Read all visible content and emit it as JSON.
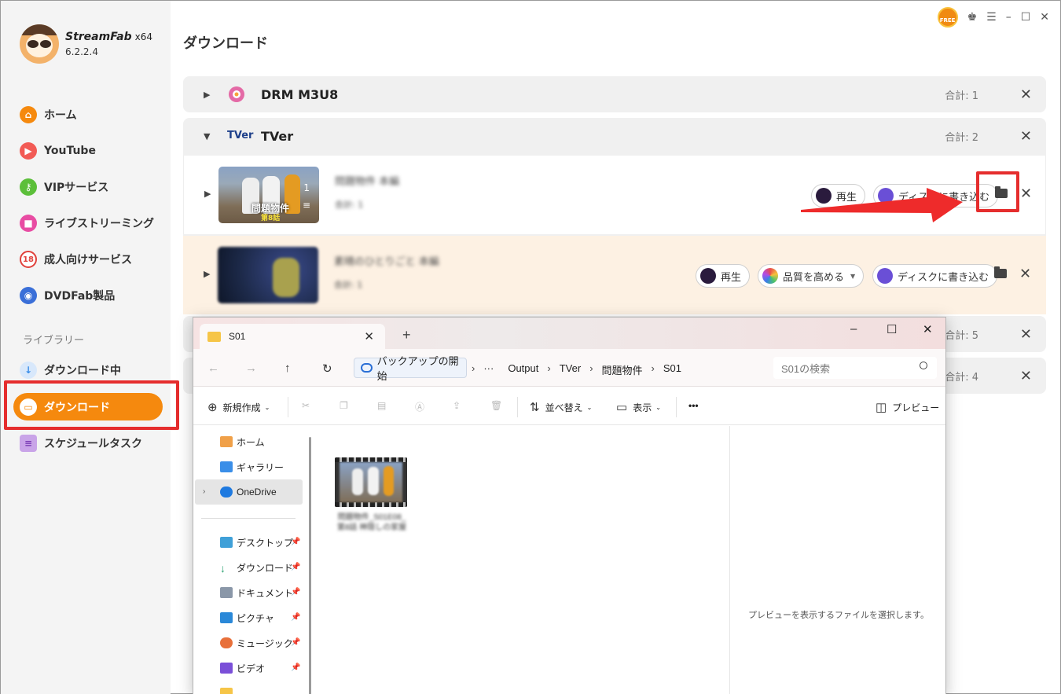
{
  "app": {
    "name": "StreamFab",
    "arch": "x64",
    "version": "6.2.2.4"
  },
  "header": {
    "title": "ダウンロード",
    "free_badge": "FREE"
  },
  "sidebar": {
    "items": [
      {
        "label": "ホーム",
        "icon": "home-icon",
        "color": "#f5890e"
      },
      {
        "label": "YouTube",
        "icon": "youtube-icon",
        "color": "#f25b55"
      },
      {
        "label": "VIPサービス",
        "icon": "key-icon",
        "color": "#5cbf3a"
      },
      {
        "label": "ライブストリーミング",
        "icon": "live-camera-icon",
        "color": "#e84ca3"
      },
      {
        "label": "成人向けサービス",
        "icon": "adult-18-icon",
        "color": "#e0413b"
      },
      {
        "label": "DVDFab製品",
        "icon": "dvdfab-icon",
        "color": "#3a6fd8"
      }
    ],
    "library_label": "ライブラリー",
    "library_items": [
      {
        "label": "ダウンロード中",
        "icon": "download-arrow-icon",
        "color": "#3a8ee8"
      },
      {
        "label": "ダウンロード",
        "icon": "folder-icon",
        "color": "#f5890e",
        "active": true
      },
      {
        "label": "スケジュールタスク",
        "icon": "schedule-icon",
        "color": "#9b59d0"
      }
    ]
  },
  "groups": [
    {
      "name": "DRM M3U8",
      "total": "合計: 1",
      "expanded": false
    },
    {
      "name": "TVer",
      "total": "合計: 2",
      "expanded": true,
      "items": [
        {
          "title": "問題物件 本編",
          "subtitle": "合計: 1",
          "thumb_count": "1",
          "thumb_caption": "問題物件",
          "thumb_episode": "第8話",
          "buttons": {
            "play": "再生",
            "burn": "ディスクに書き込む"
          }
        },
        {
          "title": "素晴のひとりごと 本編",
          "subtitle": "合計: 1",
          "buttons": {
            "play": "再生",
            "enhance": "品質を高める",
            "burn": "ディスクに書き込む"
          }
        }
      ]
    },
    {
      "name": "",
      "total": "合計: 5",
      "expanded": false
    },
    {
      "name": "",
      "total": "合計: 4",
      "expanded": false
    }
  ],
  "explorer": {
    "tab_title": "S01",
    "backup_label": "バックアップの開始",
    "breadcrumb": [
      "Output",
      "TVer",
      "問題物件",
      "S01"
    ],
    "search_placeholder": "S01の検索",
    "toolbar": {
      "new": "新規作成",
      "sort": "並べ替え",
      "view": "表示",
      "more": "•••",
      "preview": "プレビュー"
    },
    "nav": [
      {
        "label": "ホーム",
        "pinned": false
      },
      {
        "label": "ギャラリー",
        "pinned": false
      },
      {
        "label": "OneDrive",
        "pinned": false,
        "selected": true
      },
      {
        "label": "デスクトップ",
        "pinned": true
      },
      {
        "label": "ダウンロード",
        "pinned": true
      },
      {
        "label": "ドキュメント",
        "pinned": true
      },
      {
        "label": "ピクチャ",
        "pinned": true
      },
      {
        "label": "ミュージック",
        "pinned": true
      },
      {
        "label": "ビデオ",
        "pinned": true
      }
    ],
    "file": {
      "name": "問題物件_S01E08_第8話 神隠しの家屋"
    },
    "preview_message": "プレビューを表示するファイルを選択します。"
  }
}
